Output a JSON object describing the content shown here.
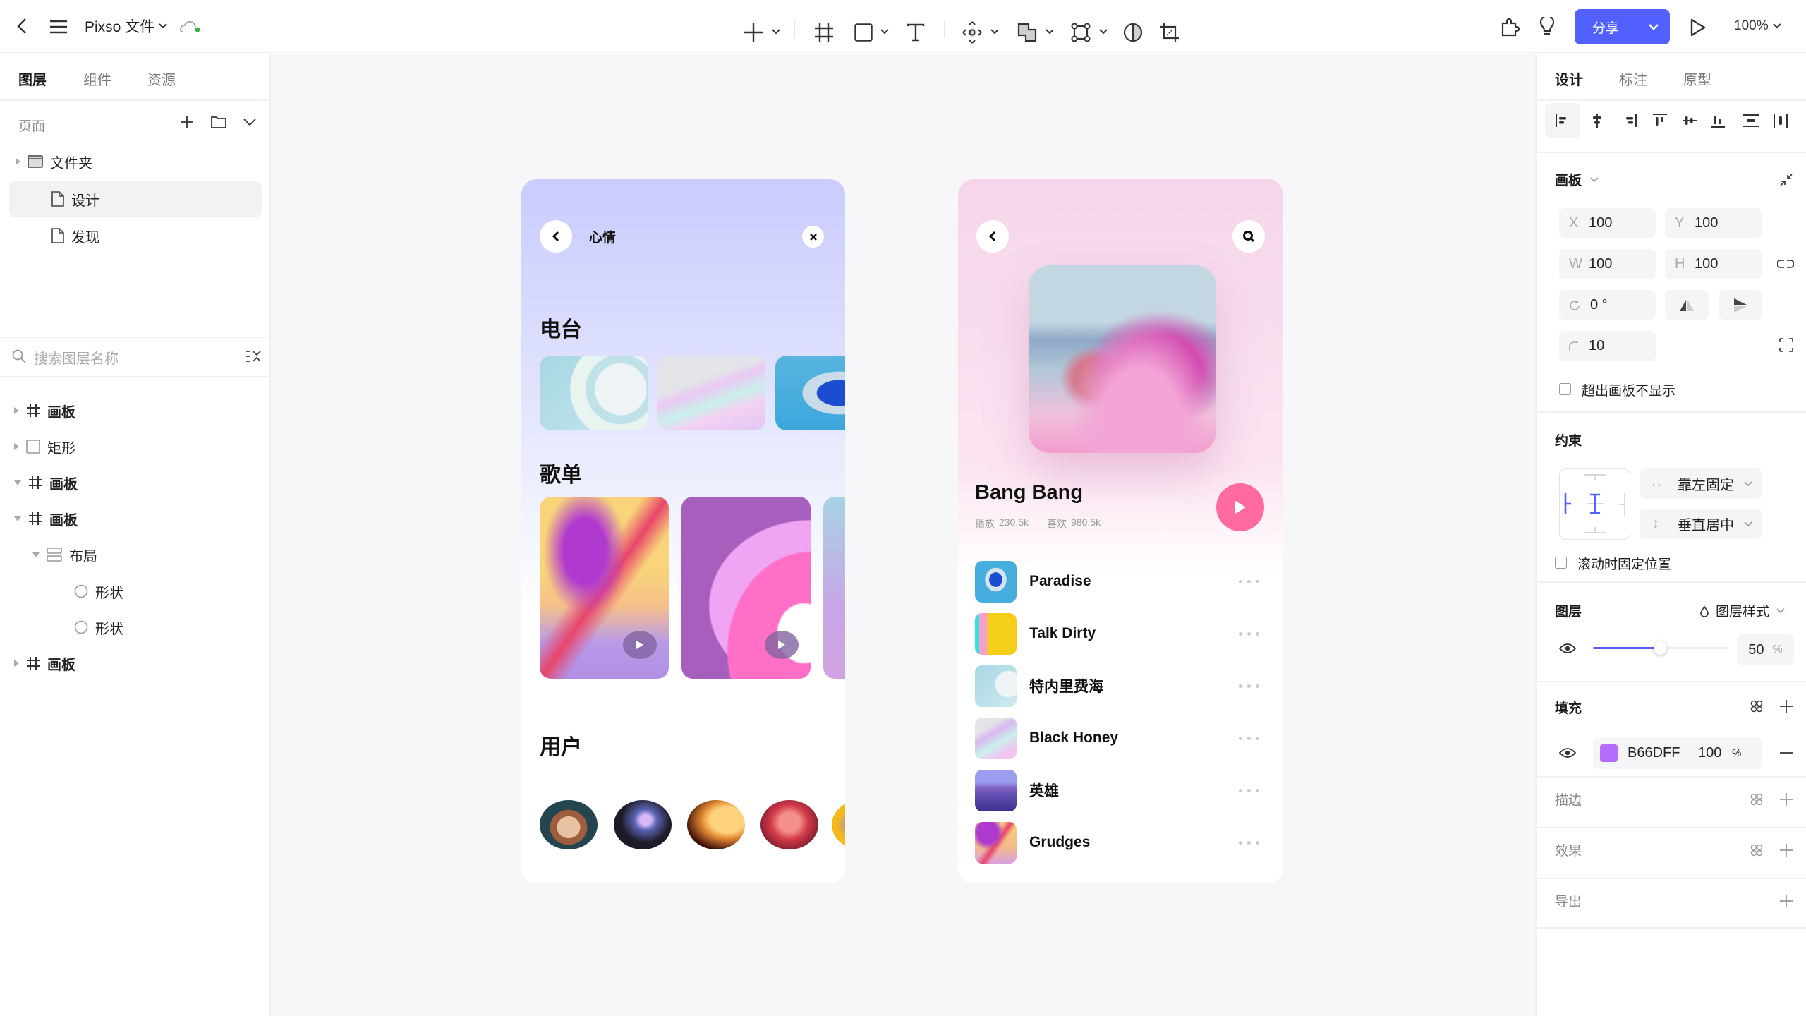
{
  "header": {
    "file_title": "Pixso 文件",
    "share_label": "分享",
    "zoom_level": "100%",
    "sync_status_color": "#3cb043",
    "accent": "#5260ff"
  },
  "toolbar": {
    "tools": [
      "add",
      "frame",
      "rectangle",
      "text",
      "component",
      "boolean",
      "vector-network",
      "mask",
      "crop"
    ]
  },
  "left_panel": {
    "tabs": [
      {
        "label": "图层",
        "active": true
      },
      {
        "label": "组件",
        "active": false
      },
      {
        "label": "资源",
        "active": false
      }
    ],
    "pages_label": "页面",
    "pages": [
      {
        "label": "文件夹",
        "type": "folder"
      },
      {
        "label": "设计",
        "type": "page",
        "selected": true
      },
      {
        "label": "发现",
        "type": "page"
      }
    ],
    "search_placeholder": "搜索图层名称",
    "layers": [
      {
        "label": "画板",
        "type": "frame",
        "expanded": false,
        "depth": 0
      },
      {
        "label": "矩形",
        "type": "rect",
        "expanded": false,
        "depth": 0
      },
      {
        "label": "画板",
        "type": "frame",
        "expanded": true,
        "depth": 0
      },
      {
        "label": "画板",
        "type": "frame",
        "expanded": true,
        "depth": 0
      },
      {
        "label": "布局",
        "type": "layout",
        "expanded": true,
        "depth": 1
      },
      {
        "label": "形状",
        "type": "ellipse",
        "depth": 2
      },
      {
        "label": "形状",
        "type": "ellipse",
        "depth": 2
      },
      {
        "label": "画板",
        "type": "frame",
        "expanded": false,
        "depth": 0
      }
    ]
  },
  "artboard1": {
    "title": "心情",
    "radio_heading": "电台",
    "playlist_heading": "歌单",
    "users_heading": "用户"
  },
  "artboard2": {
    "song_title": "Bang Bang",
    "plays_label": "播放",
    "plays_value": "230.5k",
    "likes_label": "喜欢",
    "likes_value": "980.5k",
    "play_color": "#ff6aa0",
    "songs": [
      {
        "name": "Paradise"
      },
      {
        "name": "Talk Dirty"
      },
      {
        "name": "特内里费海"
      },
      {
        "name": "Black Honey"
      },
      {
        "name": "英雄"
      },
      {
        "name": "Grudges"
      }
    ]
  },
  "right_panel": {
    "tabs": [
      {
        "label": "设计",
        "active": true
      },
      {
        "label": "标注",
        "active": false
      },
      {
        "label": "原型",
        "active": false
      }
    ],
    "frame_label": "画板",
    "x": "100",
    "y": "100",
    "w": "100",
    "h": "100",
    "x_label": "X",
    "y_label": "Y",
    "w_label": "W",
    "h_label": "H",
    "rotation": "0 °",
    "radius": "10",
    "clip_content_label": "超出画板不显示",
    "constraints_label": "约束",
    "constraint_h": "靠左固定",
    "constraint_v": "垂直居中",
    "fix_scroll_label": "滚动时固定位置",
    "layer_label": "图层",
    "layer_style_label": "图层样式",
    "opacity": "50",
    "opacity_fraction": 0.5,
    "percent": "%",
    "fill_label": "填充",
    "fill_hex": "B66DFF",
    "fill_color": "#b66dff",
    "fill_opacity": "100",
    "stroke_label": "描边",
    "effects_label": "效果",
    "export_label": "导出"
  }
}
